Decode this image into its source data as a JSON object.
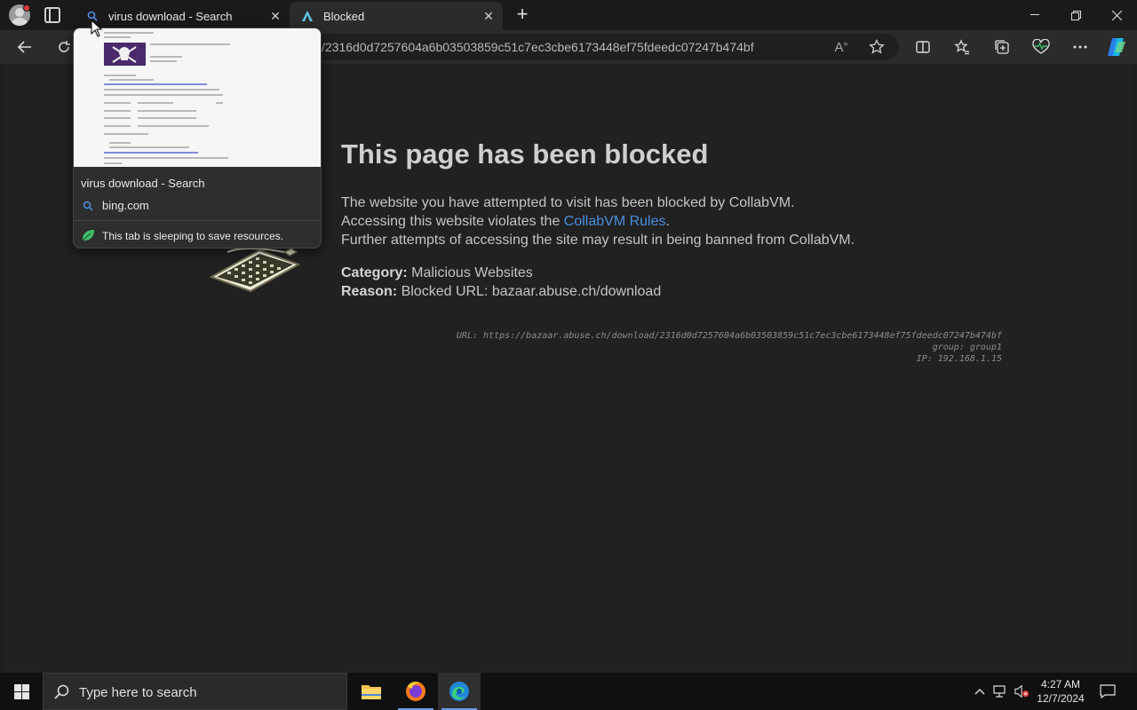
{
  "tabs": [
    {
      "title": "virus download - Search",
      "active": false
    },
    {
      "title": "Blocked",
      "active": true
    }
  ],
  "address": {
    "value": "/2316d0d7257604a6b03503859c51c7ec3cbe6173448ef75fdeedc07247b474bf"
  },
  "hovercard": {
    "title": "virus download - Search",
    "domain": "bing.com",
    "sleep_note": "This tab is sleeping to save resources."
  },
  "page": {
    "heading": "This page has been blocked",
    "line1": "The website you have attempted to visit has been blocked by CollabVM.",
    "line2_prefix": "Accessing this website violates the ",
    "line2_link": "CollabVM Rules",
    "line2_suffix": ".",
    "line3": "Further attempts of accessing the site may result in being banned from CollabVM.",
    "category_label": "Category:",
    "category_value": "Malicious Websites",
    "reason_label": "Reason:",
    "reason_value": "Blocked URL: bazaar.abuse.ch/download",
    "meta_url": "URL: https://bazaar.abuse.ch/download/2316d0d7257604a6b03503859c51c7ec3cbe6173448ef75fdeedc07247b474bf",
    "meta_group": "group: group1",
    "meta_ip": "IP: 192.168.1.15"
  },
  "taskbar": {
    "search_placeholder": "Type here to search",
    "time": "4:27 AM",
    "date": "12/7/2024"
  },
  "colors": {
    "link": "#4a8fe0",
    "page_bg": "#212121",
    "heading": "#cfcfcf"
  }
}
